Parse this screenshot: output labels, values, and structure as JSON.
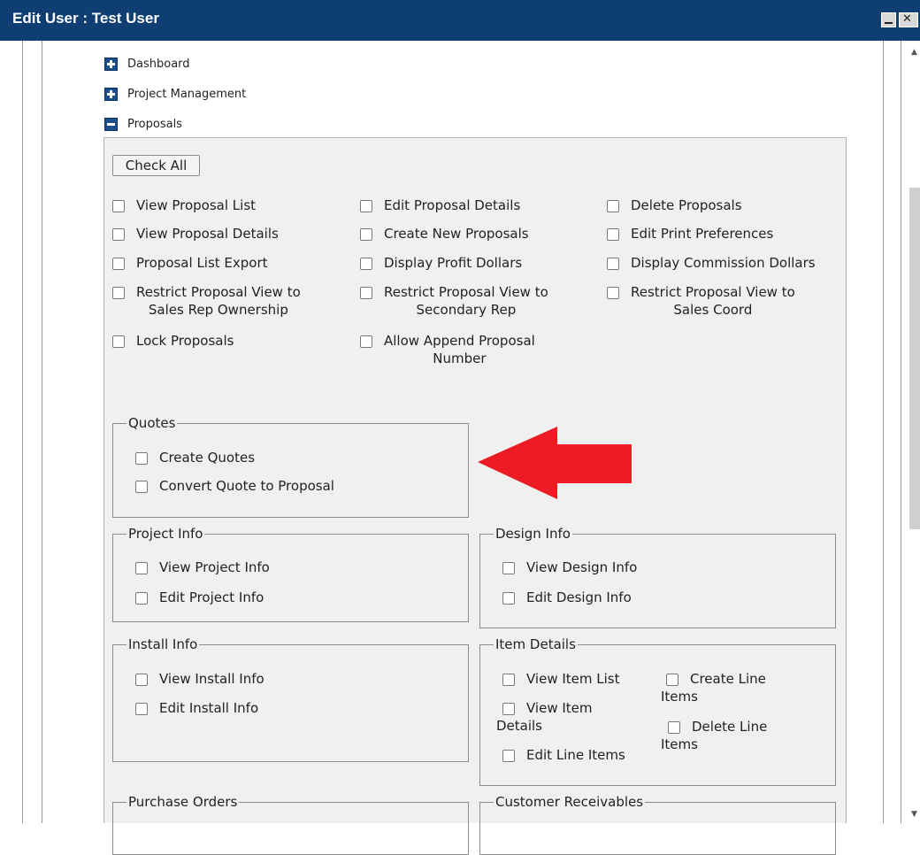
{
  "window": {
    "title": "Edit User : Test User"
  },
  "tree": [
    {
      "label": "Dashboard",
      "expanded": false
    },
    {
      "label": "Project Management",
      "expanded": false
    },
    {
      "label": "Proposals",
      "expanded": true
    }
  ],
  "proposals": {
    "check_all_label": "Check All",
    "col1": [
      {
        "label": "View Proposal List",
        "checked": false
      },
      {
        "label": "View Proposal Details",
        "checked": false
      },
      {
        "label": "Proposal List Export",
        "checked": false
      },
      {
        "label": "Restrict Proposal View to",
        "label2": "Sales Rep Ownership",
        "checked": false
      },
      {
        "label": "Lock Proposals",
        "checked": false
      }
    ],
    "col2": [
      {
        "label": "Edit Proposal Details",
        "checked": false
      },
      {
        "label": "Create New Proposals",
        "checked": false
      },
      {
        "label": "Display Profit Dollars",
        "checked": false
      },
      {
        "label": "Restrict Proposal View to",
        "label2": "Secondary Rep",
        "checked": false
      },
      {
        "label": "Allow Append Proposal",
        "label2": "Number",
        "checked": false
      }
    ],
    "col3": [
      {
        "label": "Delete Proposals",
        "checked": false
      },
      {
        "label": "Edit Print Preferences",
        "checked": false
      },
      {
        "label": "Display Commission Dollars",
        "checked": false
      },
      {
        "label": "Restrict Proposal View to",
        "label2": "Sales Coord",
        "checked": false
      }
    ]
  },
  "groups": {
    "quotes": {
      "legend": "Quotes",
      "items": [
        "Create Quotes",
        "Convert Quote to Proposal"
      ]
    },
    "project_info": {
      "legend": "Project Info",
      "items": [
        "View Project Info",
        "Edit Project Info"
      ]
    },
    "design_info": {
      "legend": "Design Info",
      "items": [
        "View Design Info",
        "Edit Design Info"
      ]
    },
    "install_info": {
      "legend": "Install Info",
      "items": [
        "View Install Info",
        "Edit Install Info"
      ]
    },
    "item_details": {
      "legend": "Item Details",
      "view_item_list": "View Item List",
      "create_line": "Create Line",
      "create_line_2": "Items",
      "view_item": "View Item",
      "view_item_2": "Details",
      "delete_line": "Delete Line",
      "delete_line_2": "Items",
      "edit_line_items": "Edit Line Items"
    },
    "purchase_orders": {
      "legend": "Purchase Orders"
    },
    "customer_receivables": {
      "legend": "Customer Receivables"
    }
  },
  "annotation": {
    "arrow_color": "#ed1c24"
  },
  "colors": {
    "titlebar": "#0e3e72",
    "panel_bg": "#f0f0f0",
    "toggle": "#1c4f8d"
  }
}
